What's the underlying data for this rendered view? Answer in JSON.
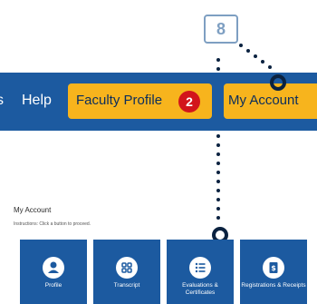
{
  "nav": {
    "partial_item": "s",
    "help": "Help",
    "faculty_profile": "Faculty Profile",
    "faculty_badge": "2",
    "my_account": "My Account"
  },
  "callout": {
    "step": "8"
  },
  "page": {
    "heading": "My Account",
    "instructions": "Instructions: Click a button to proceed."
  },
  "tiles": [
    {
      "label": "Profile",
      "icon": "user-icon"
    },
    {
      "label": "Transcript",
      "icon": "grid-icon"
    },
    {
      "label": "Evaluations & Certificates",
      "icon": "list-icon"
    },
    {
      "label": "Registrations & Receipts",
      "icon": "receipt-icon"
    }
  ],
  "colors": {
    "nav": "#1c5aa0",
    "button": "#f7b41d",
    "badge": "#d2141b",
    "tile": "#1c5aa0",
    "dots": "#0b2240"
  }
}
